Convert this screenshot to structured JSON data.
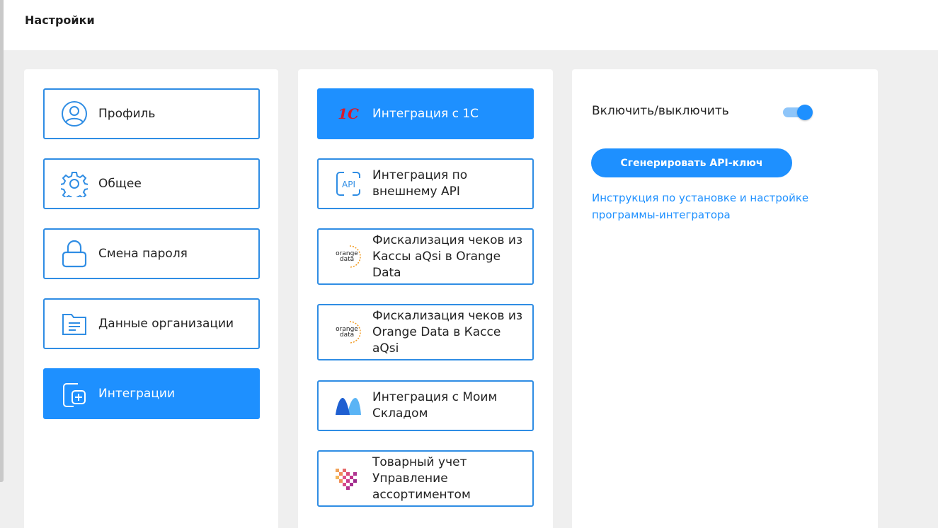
{
  "header": {
    "title": "Настройки"
  },
  "settings_menu": {
    "items": [
      {
        "label": "Профиль",
        "icon": "user-icon",
        "active": false
      },
      {
        "label": "Общее",
        "icon": "gear-icon",
        "active": false
      },
      {
        "label": "Смена пароля",
        "icon": "lock-icon",
        "active": false
      },
      {
        "label": "Данные организации",
        "icon": "folder-document-icon",
        "active": false
      },
      {
        "label": "Интеграции",
        "icon": "integration-icon",
        "active": true
      }
    ]
  },
  "integrations": {
    "items": [
      {
        "label": "Интеграция с 1С",
        "icon": "1c-logo-icon",
        "logo_text": "1С",
        "active": true
      },
      {
        "label": "Интеграция по внешнему API",
        "icon": "api-icon",
        "logo_text": "API",
        "active": false
      },
      {
        "label": "Фискализация чеков из Кассы aQsi в Orange Data",
        "icon": "orange-data-logo-icon",
        "logo_text": "orange data",
        "active": false
      },
      {
        "label": "Фискализация чеков из Orange Data в Кассе aQsi",
        "icon": "orange-data-logo-icon",
        "logo_text": "orange data",
        "active": false
      },
      {
        "label": "Интеграция с Моим Складом",
        "icon": "moysklad-logo-icon",
        "active": false
      },
      {
        "label": "Товарный учет Управление ассортиментом",
        "icon": "pixel-logo-icon",
        "active": false
      }
    ]
  },
  "detail": {
    "toggle_label": "Включить/выключить",
    "toggle_on": true,
    "generate_button_label": "Сгенерировать API-ключ",
    "instruction_link": "Инструкция по установке и настройке программы-интегратора"
  },
  "colors": {
    "accent": "#1e90ff",
    "border": "#2f8de4",
    "toggle_track": "#8ec5f9",
    "background": "#efefef"
  }
}
